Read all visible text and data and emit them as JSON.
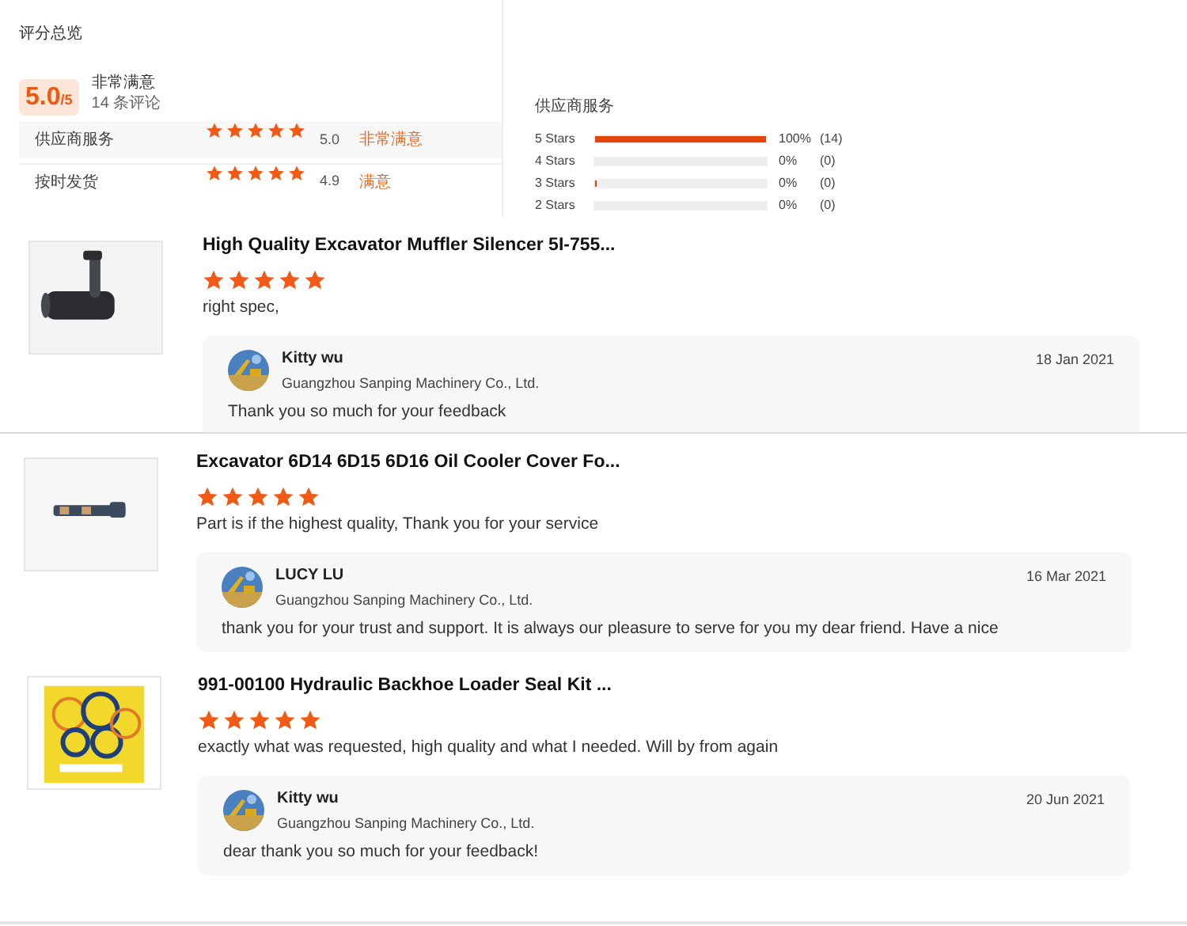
{
  "summary": {
    "title": "评分总览",
    "score": "5.0",
    "out_of": "/5",
    "verdict": "非常满意",
    "count": "14 条评论",
    "ratings": [
      {
        "label": "供应商服务",
        "stars": 5,
        "value": "5.0",
        "verdict": "非常满意"
      },
      {
        "label": "按时发货",
        "stars": 5,
        "value": "4.9",
        "verdict": "满意"
      }
    ]
  },
  "breakdown": {
    "title": "供应商服务",
    "rows": [
      {
        "label": "5 Stars",
        "level": 1,
        "percent": "100%",
        "count": "(14)"
      },
      {
        "label": "4 Stars",
        "level": 0,
        "percent": "0%",
        "count": "(0)"
      },
      {
        "label": "3 Stars",
        "level": 0.01,
        "percent": "0%",
        "count": "(0)"
      },
      {
        "label": "2 Stars",
        "level": 0,
        "percent": "0%",
        "count": "(0)"
      }
    ]
  },
  "reviews": [
    {
      "product": "High Quality Excavator Muffler Silencer 5I-755...",
      "stars": 5,
      "comment": "right spec,",
      "reply": {
        "name": "Kitty wu",
        "company": "Guangzhou Sanping Machinery Co., Ltd.",
        "date": "18 Jan 2021",
        "text": "Thank you so much for your feedback"
      }
    },
    {
      "product": "Excavator 6D14 6D15 6D16 Oil Cooler Cover Fo...",
      "stars": 5,
      "comment": "Part is if the highest quality, Thank you for your service",
      "reply": {
        "name": "LUCY LU",
        "company": "Guangzhou Sanping Machinery Co., Ltd.",
        "date": "16 Mar 2021",
        "text": "thank you for your trust and support. It is always our pleasure to serve for you my dear friend. Have a nice"
      }
    },
    {
      "product": "991-00100 Hydraulic Backhoe Loader Seal Kit ...",
      "stars": 5,
      "comment": "exactly what was requested, high quality and what I needed. Will by from again",
      "reply": {
        "name": "Kitty wu",
        "company": "Guangzhou Sanping Machinery Co., Ltd.",
        "date": "20 Jun 2021",
        "text": "dear thank you so much for your feedback!"
      }
    }
  ]
}
